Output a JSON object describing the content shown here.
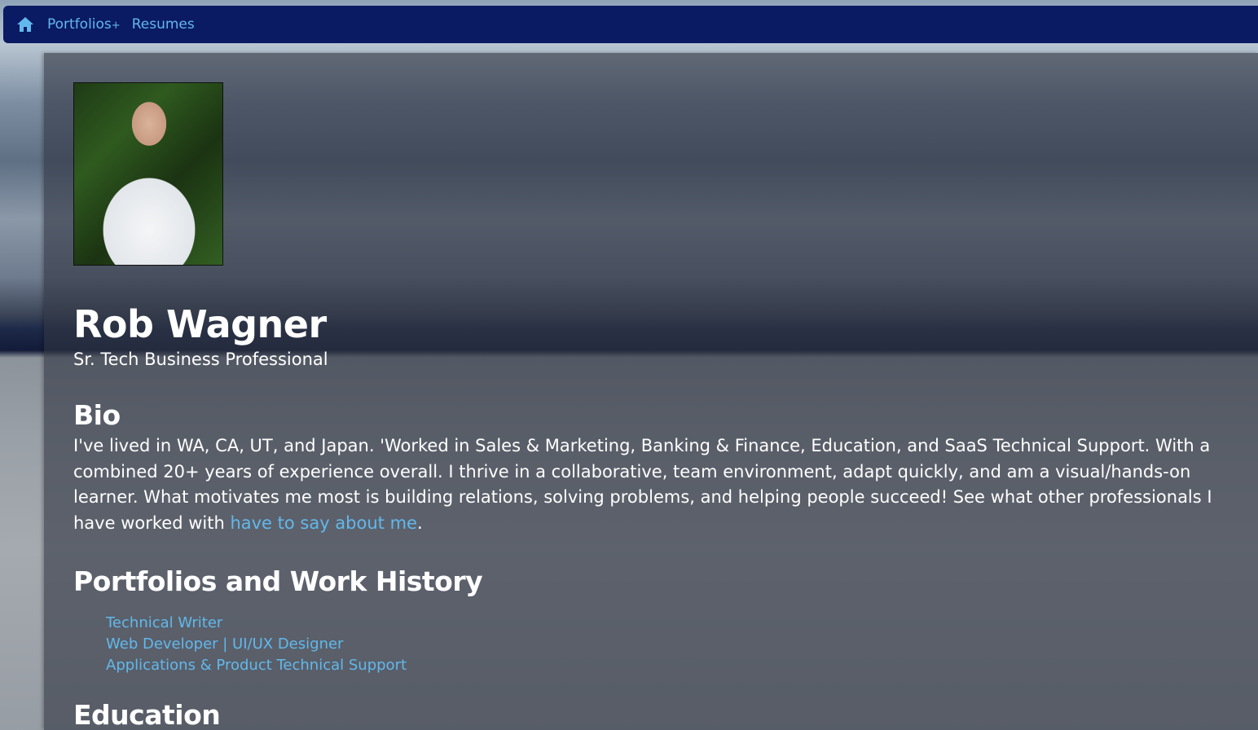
{
  "nav": {
    "home_icon": "home-icon",
    "portfolios_label": "Portfolios",
    "portfolios_suffix": "+",
    "resumes_label": "Resumes",
    "bar_color": "#0a1a63",
    "link_color": "#62b8ec"
  },
  "profile": {
    "name": "Rob Wagner",
    "title": "Sr. Tech Business Professional"
  },
  "bio": {
    "heading": "Bio",
    "text": "I've lived in WA, CA, UT, and Japan. 'Worked in Sales & Marketing, Banking & Finance, Education, and SaaS Technical Support. With a combined 20+ years of experience overall. I thrive in a collaborative, team environment, adapt quickly, and am a visual/hands-on learner. What motivates me most is building relations, solving problems, and helping people succeed! See what other professionals I have worked with ",
    "link_text": "have to say about me",
    "trailing": "."
  },
  "portfolios": {
    "heading": "Portfolios and Work History",
    "items": [
      "Technical Writer",
      "Web Developer | UI/UX Designer",
      "Applications & Product Technical Support"
    ]
  },
  "education": {
    "heading": "Education"
  }
}
